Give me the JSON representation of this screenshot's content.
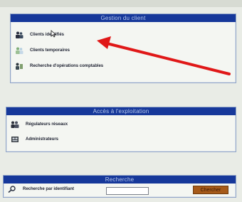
{
  "top_strip_text": "",
  "panel_clients": {
    "title": "Gestion du client",
    "items": [
      {
        "label": "Clients identifiés"
      },
      {
        "label": "Clients temporaires"
      },
      {
        "label": "Recherche d'opérations comptables"
      }
    ]
  },
  "panel_admin": {
    "title": "Accès à l'exploitation",
    "items": [
      {
        "label": "Régulateurs réseaux"
      },
      {
        "label": "Administrateurs"
      }
    ]
  },
  "panel_search": {
    "title": "Recherche",
    "row_label": "Recherche par identifiant",
    "input_value": "",
    "button_label": "Chercher"
  },
  "colors": {
    "header_bg": "#16389a",
    "arrow": "#e01818",
    "button_bg": "#a65a1a"
  }
}
